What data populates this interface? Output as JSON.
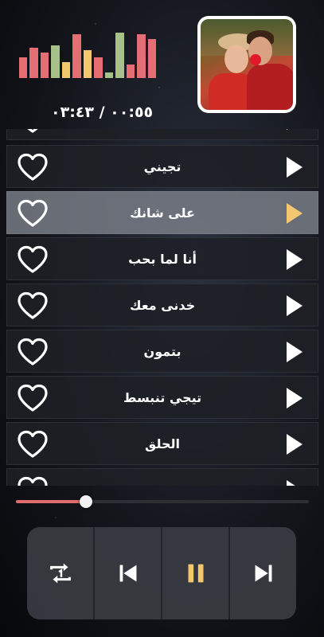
{
  "player": {
    "time_display": "٠٠:٥٥ / ٠٣:٤٣",
    "progress": 0.24
  },
  "equalizer": {
    "bars": [
      {
        "level": 0.45,
        "color": "#e56d74"
      },
      {
        "level": 0.65,
        "color": "#e56d74"
      },
      {
        "level": 0.55,
        "color": "#e56d74"
      },
      {
        "level": 0.7,
        "color": "#a8c08a"
      },
      {
        "level": 0.35,
        "color": "#f3c76f"
      },
      {
        "level": 0.95,
        "color": "#e56d74"
      },
      {
        "level": 0.6,
        "color": "#f3c76f"
      },
      {
        "level": 0.45,
        "color": "#e56d74"
      },
      {
        "level": 0.12,
        "color": "#a8c08a"
      },
      {
        "level": 0.98,
        "color": "#a8c08a"
      },
      {
        "level": 0.3,
        "color": "#e56d74"
      },
      {
        "level": 0.95,
        "color": "#e56d74"
      },
      {
        "level": 0.85,
        "color": "#e56d74"
      }
    ]
  },
  "songs": [
    {
      "title": "",
      "active": false,
      "partial": "top"
    },
    {
      "title": "تجيني",
      "active": false
    },
    {
      "title": "على شانك",
      "active": true
    },
    {
      "title": "أنا لما بحب",
      "active": false
    },
    {
      "title": "خدنى معك",
      "active": false
    },
    {
      "title": "بتمون",
      "active": false
    },
    {
      "title": "تيجي تنبسط",
      "active": false
    },
    {
      "title": "الحلق",
      "active": false
    },
    {
      "title": "",
      "active": false,
      "partial": "bottom"
    }
  ],
  "icons": {
    "heart": "heart-outline-icon",
    "play": "play-icon",
    "repeat": "repeat-one-icon",
    "previous": "skip-previous-icon",
    "pause": "pause-icon",
    "next": "skip-next-icon"
  },
  "colors": {
    "accent": "#f3c76f",
    "progress": "#e06d6d",
    "active_row": "#7c808a",
    "row": "#1e2026"
  }
}
